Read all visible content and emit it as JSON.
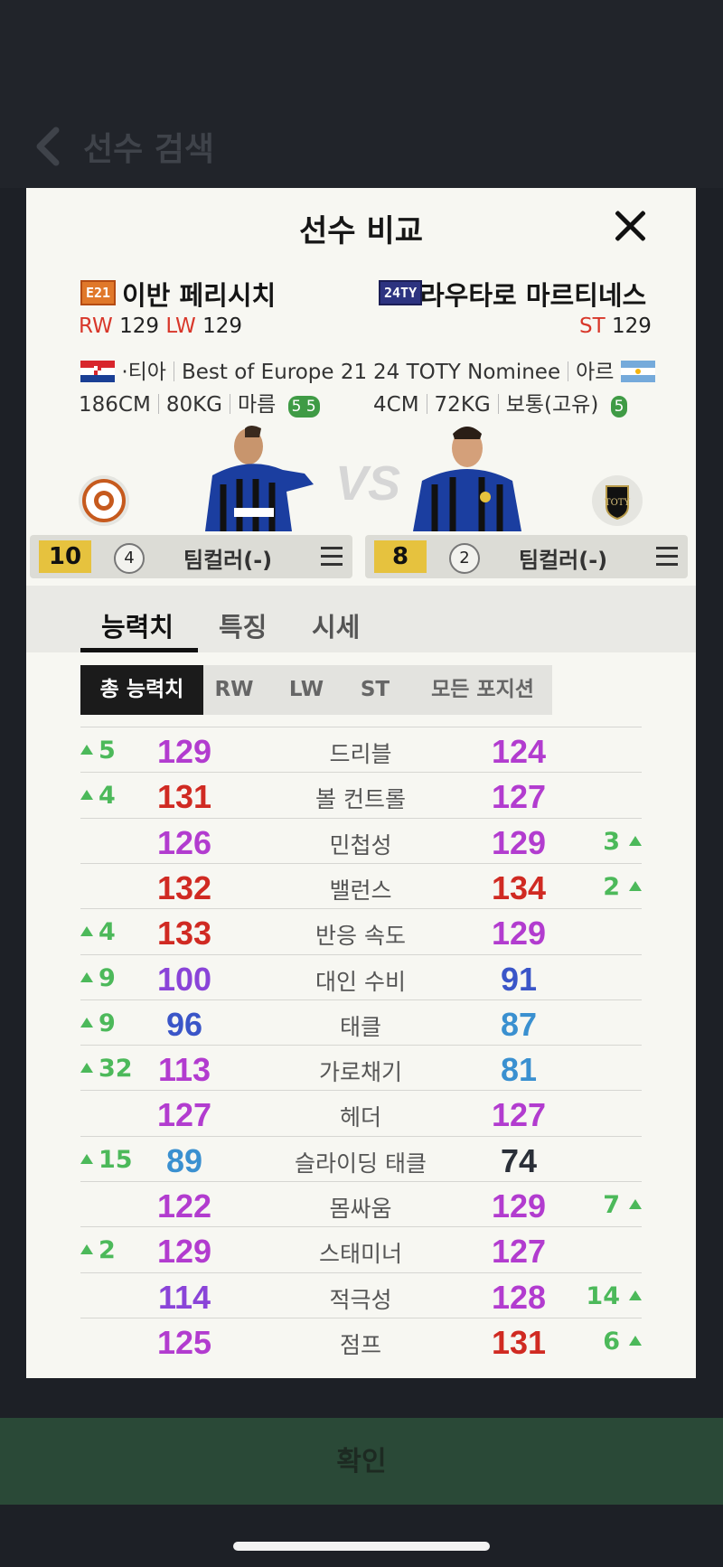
{
  "background": {
    "title": "선수 검색",
    "confirm_label": "확인"
  },
  "modal": {
    "title": "선수 비교",
    "left": {
      "season_badge": "E21",
      "name": "이반 페리시치",
      "pos1": "RW",
      "ovr1": "129",
      "pos2": "LW",
      "ovr2": "129",
      "nation": "·티아",
      "season": "Best of Europe 21",
      "height": "186CM",
      "weight": "80KG",
      "body": "마름",
      "foot": "5 5",
      "level": "10",
      "grade": "4",
      "team_color": "팀컬러(-)"
    },
    "right": {
      "season_badge": "24TY",
      "name": "라우타로 마르티네스",
      "pos1": "ST",
      "ovr1": "129",
      "season": "24 TOTY Nominee",
      "nation": "아르",
      "height": "4CM",
      "weight": "72KG",
      "body": "보통(고유)",
      "foot": "5",
      "level": "8",
      "grade": "2",
      "team_color": "팀컬러(-)"
    },
    "vs": "VS",
    "tabs": [
      "능력치",
      "특징",
      "시세"
    ],
    "subtabs": [
      "총 능력치",
      "RW",
      "LW",
      "ST",
      "모든 포지션"
    ],
    "stats": [
      {
        "label": "드리블",
        "left": "129",
        "right": "124",
        "ld": "5",
        "rd": "",
        "lc": "#b23ccf",
        "rc": "#b23ccf"
      },
      {
        "label": "볼 컨트롤",
        "left": "131",
        "right": "127",
        "ld": "4",
        "rd": "",
        "lc": "#d02a22",
        "rc": "#b23ccf"
      },
      {
        "label": "민첩성",
        "left": "126",
        "right": "129",
        "ld": "",
        "rd": "3",
        "lc": "#b23ccf",
        "rc": "#b23ccf"
      },
      {
        "label": "밸런스",
        "left": "132",
        "right": "134",
        "ld": "",
        "rd": "2",
        "lc": "#d02a22",
        "rc": "#d02a22"
      },
      {
        "label": "반응 속도",
        "left": "133",
        "right": "129",
        "ld": "4",
        "rd": "",
        "lc": "#d02a22",
        "rc": "#b23ccf"
      },
      {
        "label": "대인 수비",
        "left": "100",
        "right": "91",
        "ld": "9",
        "rd": "",
        "lc": "#8a44d8",
        "rc": "#3a55c8"
      },
      {
        "label": "태클",
        "left": "96",
        "right": "87",
        "ld": "9",
        "rd": "",
        "lc": "#3a55c8",
        "rc": "#3a90d0"
      },
      {
        "label": "가로채기",
        "left": "113",
        "right": "81",
        "ld": "32",
        "rd": "",
        "lc": "#b23ccf",
        "rc": "#3a90d0"
      },
      {
        "label": "헤더",
        "left": "127",
        "right": "127",
        "ld": "",
        "rd": "",
        "lc": "#b23ccf",
        "rc": "#b23ccf"
      },
      {
        "label": "슬라이딩 태클",
        "left": "89",
        "right": "74",
        "ld": "15",
        "rd": "",
        "lc": "#3a90d0",
        "rc": "#2a2f38"
      },
      {
        "label": "몸싸움",
        "left": "122",
        "right": "129",
        "ld": "",
        "rd": "7",
        "lc": "#b23ccf",
        "rc": "#b23ccf"
      },
      {
        "label": "스태미너",
        "left": "129",
        "right": "127",
        "ld": "2",
        "rd": "",
        "lc": "#b23ccf",
        "rc": "#b23ccf"
      },
      {
        "label": "적극성",
        "left": "114",
        "right": "128",
        "ld": "",
        "rd": "14",
        "lc": "#8a44d8",
        "rc": "#b23ccf"
      },
      {
        "label": "점프",
        "left": "125",
        "right": "131",
        "ld": "",
        "rd": "6",
        "lc": "#b23ccf",
        "rc": "#d02a22"
      }
    ]
  }
}
